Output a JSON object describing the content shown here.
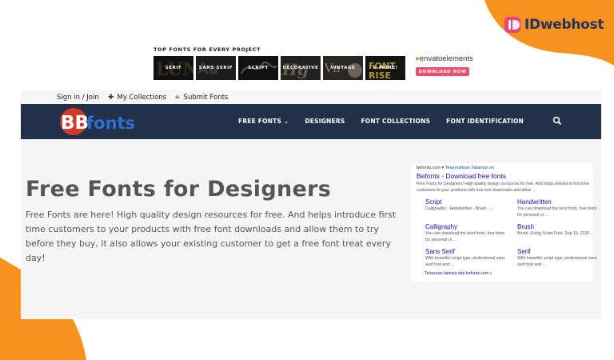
{
  "brand": {
    "name": "IDwebhost",
    "mark_color": "#e8417c",
    "text_color": "#23325e",
    "accent_orange": "#f7921e"
  },
  "ad": {
    "heading": "TOP FONTS FOR EVERY PROJECT",
    "tiles": [
      "SERIF",
      "SANS SERIF",
      "SCRIPT",
      "DECORATIVE",
      "VINTAGE",
      "& MORE!"
    ],
    "envato": {
      "brand": "envato",
      "product": "elements"
    },
    "download_label": "DOWNLOAD NOW",
    "download_color": "#e8506f"
  },
  "site": {
    "topbar": {
      "signin": "Sign in / Join",
      "collections": "My Collections",
      "submit": "Submit Fonts"
    },
    "logo": {
      "bb": "BB",
      "fonts": "fonts"
    },
    "nav": [
      "FREE FONTS",
      "DESIGNERS",
      "FONT COLLECTIONS",
      "FONT IDENTIFICATION"
    ],
    "nav_bg": "#22304a",
    "hero": {
      "title": "Free Fonts for Designers",
      "text": "Free Fonts are here! High quality design resources for free. And helps introduce first time customers to your products with free font downloads and allow them to try before they buy, it also allows your existing customer to get a free font treat every day!"
    },
    "serp": {
      "url": "befonts.com",
      "translate": "Terjemahkan halaman ini",
      "title": "Befonts - Download free fonts",
      "snippet": "Free Fonts for Designers! High quality design resources for free. And helps introduce first time customers to your products with free font downloads and allow ...",
      "sitelinks": [
        {
          "title": "Script",
          "desc": "Calligraphy - Handwritten - Brush - ..."
        },
        {
          "title": "Handwritten",
          "desc": "You can download the best fonts, free fonts for personal or ..."
        },
        {
          "title": "Calligraphy",
          "desc": "You can download the best fonts, free fonts for personal or ..."
        },
        {
          "title": "Brush",
          "desc": "Brush. Entog Script Font. Sep 15, 2020 ..."
        },
        {
          "title": "Sans Serif",
          "desc": "With beautiful script type, professional sans serif font and ..."
        },
        {
          "title": "Serif",
          "desc": "With beautiful script type, professional sans serif font and ..."
        }
      ],
      "more": "Telusuran lainnya dari befonts.com »"
    }
  }
}
